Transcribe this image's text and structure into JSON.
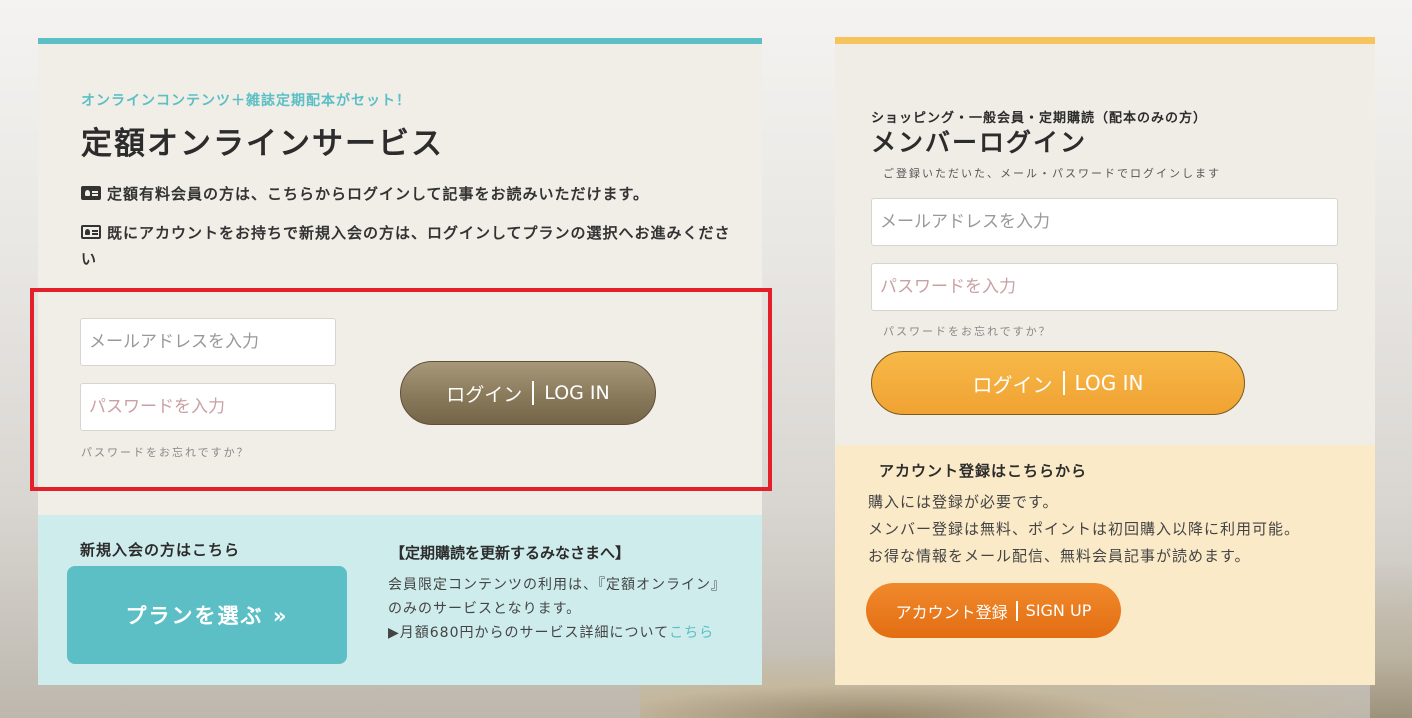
{
  "left": {
    "subtitle": "オンラインコンテンツ＋雑誌定期配本がセット！",
    "title": "定額オンラインサービス",
    "info_line_1": "定額有料会員の方は、こちらからログインして記事をお読みいただけます。",
    "info_line_2": "既にアカウントをお持ちで新規入会の方は、ログインしてプランの選択へお進みください",
    "email_placeholder": "メールアドレスを入力",
    "password_placeholder": "パスワードを入力",
    "forgot_password": "パスワードをお忘れですか？",
    "login_button_ja": "ログイン",
    "login_button_en": "LOG IN",
    "highlight_color": "#e3202a",
    "accent_color": "#5bbfc5"
  },
  "new_member": {
    "title": "新規入会の方はこちら",
    "plan_button": "プランを選ぶ »",
    "renew_title": "【定期購読を更新するみなさまへ】",
    "renew_text": "会員限定コンテンツの利用は、『定額オンライン』のみのサービスとなります。",
    "renew_text_2": "▶月額680円からのサービス詳細について",
    "renew_link": "こちら"
  },
  "right": {
    "subtitle": "ショッピング・一般会員・定期購読（配本のみの方）",
    "title": "メンバーログイン",
    "note": "ご登録いただいた、メール・パスワードでログインします",
    "email_placeholder": "メールアドレスを入力",
    "password_placeholder": "パスワードを入力",
    "forgot_password": "パスワードをお忘れですか？",
    "login_button_ja": "ログイン",
    "login_button_en": "LOG IN",
    "accent_color": "#f6c35d"
  },
  "account": {
    "title": "アカウント登録はこちらから",
    "line_1": "購入には登録が必要です。",
    "line_2": "メンバー登録は無料、ポイントは初回購入以降に利用可能。",
    "line_3": "お得な情報をメール配信、無料会員記事が読めます。",
    "signup_ja": "アカウント登録",
    "signup_en": "SIGN UP"
  }
}
